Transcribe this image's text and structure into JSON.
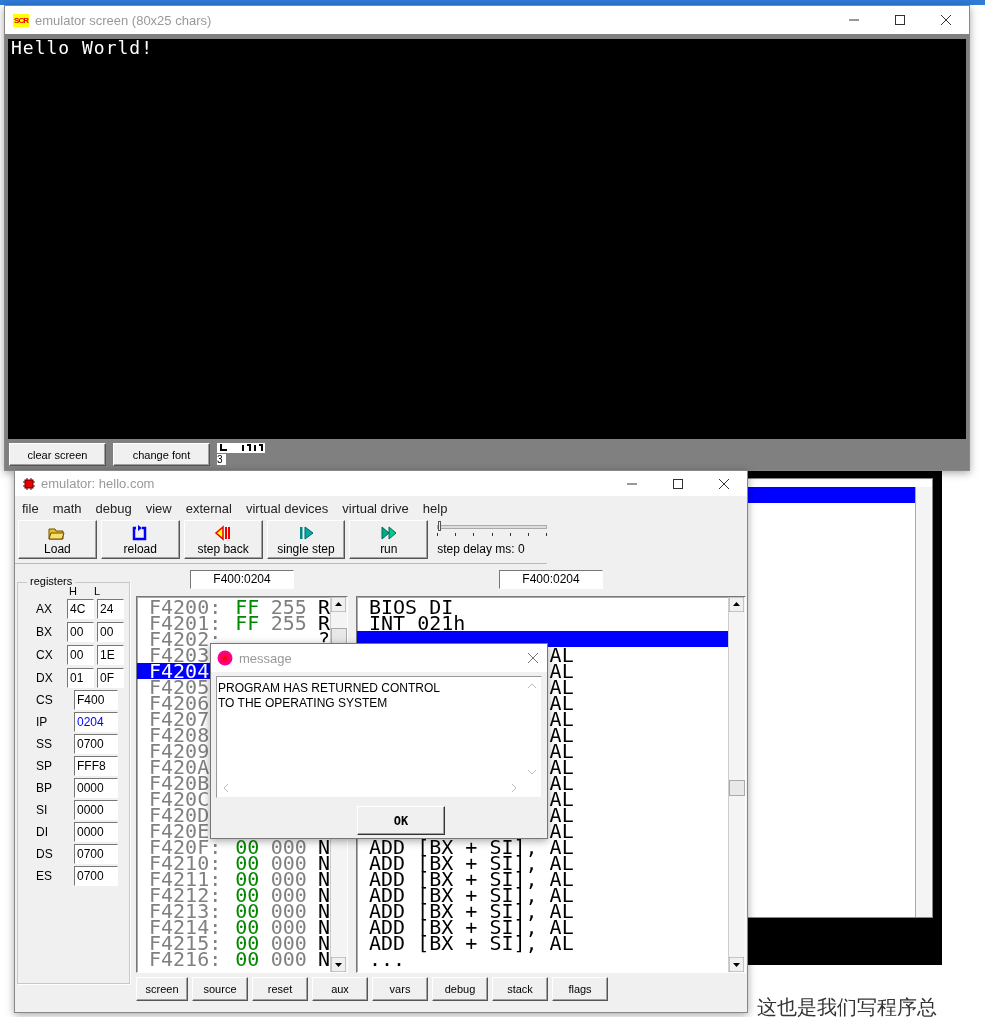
{
  "screen_window": {
    "icon_text": "SCR",
    "title": "emulator screen (80x25 chars)",
    "output_lines": [
      "Hello World!"
    ],
    "buttons": [
      "clear screen",
      "change font"
    ],
    "font_size": "3"
  },
  "emulator_window": {
    "title": "emulator: hello.com",
    "menu": [
      "file",
      "math",
      "debug",
      "view",
      "external",
      "virtual devices",
      "virtual drive",
      "help"
    ],
    "toolbar": [
      {
        "label": "Load",
        "kind": "load"
      },
      {
        "label": "reload",
        "kind": "reload"
      },
      {
        "label": "step back",
        "kind": "back"
      },
      {
        "label": "single step",
        "kind": "step"
      },
      {
        "label": "run",
        "kind": "run"
      }
    ],
    "step_delay": {
      "label": "step delay ms: 0",
      "level": 0
    },
    "address_fields": [
      "F400:0204",
      "F400:0204"
    ],
    "registers": {
      "title": "registers",
      "high_label": "H",
      "low_label": "L",
      "pairs": [
        {
          "name": "AX",
          "high": "4C",
          "low": "24"
        },
        {
          "name": "BX",
          "high": "00",
          "low": "00"
        },
        {
          "name": "CX",
          "high": "00",
          "low": "1E"
        },
        {
          "name": "DX",
          "high": "01",
          "low": "0F"
        }
      ],
      "words": [
        {
          "name": "CS",
          "value": "F400",
          "changed": false
        },
        {
          "name": "IP",
          "value": "0204",
          "changed": true
        },
        {
          "name": "SS",
          "value": "0700",
          "changed": false
        },
        {
          "name": "SP",
          "value": "FFF8",
          "changed": false
        },
        {
          "name": "BP",
          "value": "0000",
          "changed": false
        },
        {
          "name": "SI",
          "value": "0000",
          "changed": false
        },
        {
          "name": "DI",
          "value": "0000",
          "changed": false
        },
        {
          "name": "DS",
          "value": "0700",
          "changed": false
        },
        {
          "name": "ES",
          "value": "0700",
          "changed": false
        }
      ]
    },
    "memory": [
      {
        "address": "F4200:",
        "hex": "FF",
        "dec": "255",
        "char": "R",
        "selected": false
      },
      {
        "address": "F4201:",
        "hex": "FF",
        "dec": "255",
        "char": "R",
        "selected": false
      },
      {
        "address": "F4202:",
        "char": "?",
        "selected": false
      },
      {
        "address": "F4203",
        "selected": false
      },
      {
        "address": "F4204",
        "selected": true
      },
      {
        "address": "F4205",
        "selected": false
      },
      {
        "address": "F4206",
        "selected": false
      },
      {
        "address": "F4207",
        "selected": false
      },
      {
        "address": "F4208",
        "selected": false
      },
      {
        "address": "F4209",
        "selected": false
      },
      {
        "address": "F420A",
        "selected": false
      },
      {
        "address": "F420B",
        "selected": false
      },
      {
        "address": "F420C",
        "selected": false
      },
      {
        "address": "F420D",
        "selected": false
      },
      {
        "address": "F420E",
        "selected": false
      },
      {
        "address": "F420F:",
        "hex": "00",
        "dec": "000",
        "char": "N",
        "selected": false
      },
      {
        "address": "F4210:",
        "hex": "00",
        "dec": "000",
        "char": "N",
        "selected": false
      },
      {
        "address": "F4211:",
        "hex": "00",
        "dec": "000",
        "char": "N",
        "selected": false
      },
      {
        "address": "F4212:",
        "hex": "00",
        "dec": "000",
        "char": "N",
        "selected": false
      },
      {
        "address": "F4213:",
        "hex": "00",
        "dec": "000",
        "char": "N",
        "selected": false
      },
      {
        "address": "F4214:",
        "hex": "00",
        "dec": "000",
        "char": "N",
        "selected": false
      },
      {
        "address": "F4215:",
        "hex": "00",
        "dec": "000",
        "char": "N",
        "selected": false
      },
      {
        "address": "F4216:",
        "hex": "00",
        "dec": "000",
        "char": "N",
        "selected": false
      }
    ],
    "disassembly": [
      {
        "text": "BIOS DI",
        "selected": false
      },
      {
        "text": "INT 021h",
        "selected": false
      },
      {
        "selected": true
      },
      {
        "tail": "AL",
        "selected": false
      },
      {
        "tail": "AL",
        "selected": false
      },
      {
        "tail": "AL",
        "selected": false
      },
      {
        "tail": "AL",
        "selected": false
      },
      {
        "tail": "AL",
        "selected": false
      },
      {
        "tail": "AL",
        "selected": false
      },
      {
        "tail": "AL",
        "selected": false
      },
      {
        "tail": "AL",
        "selected": false
      },
      {
        "tail": "AL",
        "selected": false
      },
      {
        "tail": "AL",
        "selected": false
      },
      {
        "tail": "AL",
        "selected": false
      },
      {
        "tail": "AL",
        "selected": false
      },
      {
        "text": "ADD [BX + SI], AL",
        "selected": false
      },
      {
        "text": "ADD [BX + SI], AL",
        "selected": false
      },
      {
        "text": "ADD [BX + SI], AL",
        "selected": false
      },
      {
        "text": "ADD [BX + SI], AL",
        "selected": false
      },
      {
        "text": "ADD [BX + SI], AL",
        "selected": false
      },
      {
        "text": "ADD [BX + SI], AL",
        "selected": false
      },
      {
        "text": "ADD [BX + SI], AL",
        "selected": false
      },
      {
        "text": "...",
        "selected": false
      }
    ],
    "bottom_buttons": [
      "screen",
      "source",
      "reset",
      "aux",
      "vars",
      "debug",
      "stack",
      "flags"
    ]
  },
  "message_dialog": {
    "title": "message",
    "lines": [
      "PROGRAM HAS RETURNED CONTROL",
      "TO THE OPERATING SYSTEM"
    ],
    "button": "OK"
  },
  "background_text": "这也是我们写程序总"
}
